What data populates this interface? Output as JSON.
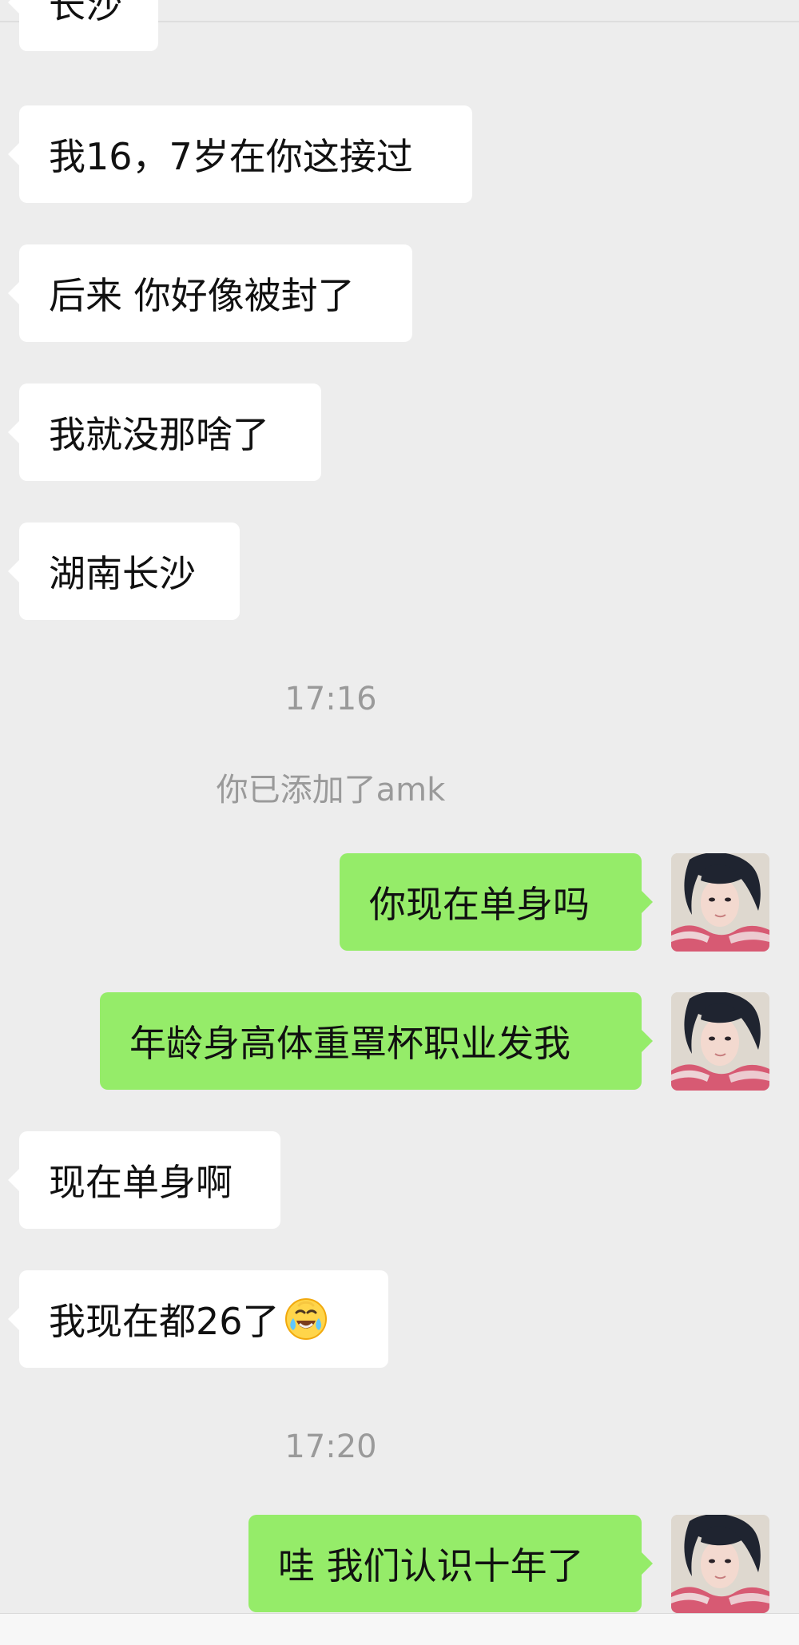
{
  "chat": {
    "messages": [
      {
        "text": "长沙"
      },
      {
        "text": "我16，7岁在你这接过"
      },
      {
        "text": "后来 你好像被封了"
      },
      {
        "text": "我就没那啥了"
      },
      {
        "text": "湖南长沙"
      },
      {
        "time": "17:16"
      },
      {
        "system": "你已添加了amk"
      },
      {
        "text": "你现在单身吗"
      },
      {
        "text": "年龄身高体重罩杯职业发我"
      },
      {
        "text": "现在单身啊"
      },
      {
        "text": "我现在都26了"
      },
      {
        "time": "17:20"
      },
      {
        "text": "哇 我们认识十年了"
      }
    ]
  },
  "icons": {
    "emoji": "laughing-crying-emoji",
    "avatar": "user-avatar"
  },
  "colors": {
    "background": "#ededed",
    "incoming_bubble": "#ffffff",
    "outgoing_bubble": "#95ec69",
    "meta_text": "#9a9a9a"
  }
}
